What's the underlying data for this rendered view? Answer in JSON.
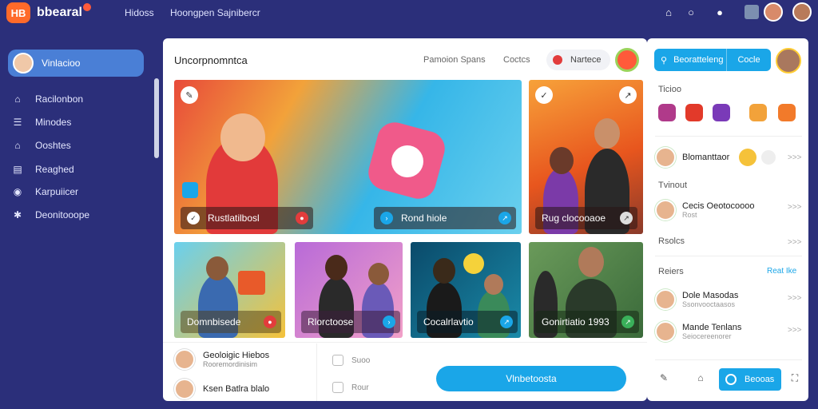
{
  "app": {
    "logo_badge": "HB",
    "logo_text": "bbearal",
    "nav": [
      "Hidoss",
      "Hoongpen Sajnibercr"
    ]
  },
  "sidebar": {
    "user_name": "Vinlacioo",
    "items": [
      {
        "label": "Racilonbon",
        "icon": "home-icon"
      },
      {
        "label": "Minodes",
        "icon": "list-icon"
      },
      {
        "label": "Ooshtes",
        "icon": "stack-icon"
      },
      {
        "label": "Reaghed",
        "icon": "calendar-icon"
      },
      {
        "label": "Karpuiicer",
        "icon": "globe-icon"
      },
      {
        "label": "Deonitooope",
        "icon": "puzzle-icon"
      }
    ]
  },
  "main": {
    "title": "Uncorpnomntca",
    "tabs": [
      "Pamoion Spans",
      "Coctcs"
    ],
    "pill_label": "Nartece",
    "cards": [
      {
        "label": "Rustlatilbosl"
      },
      {
        "label": "Rond hiole"
      },
      {
        "label": "Rug clocooaoe"
      },
      {
        "label": "Domnbisede"
      },
      {
        "label": "Rlorctoose"
      },
      {
        "label": "Cocalrlavtio"
      },
      {
        "label": "Gonirtiatio 1993"
      }
    ],
    "list": [
      {
        "name": "Geoloigic Hiebos",
        "sub": "Rooremordinisim"
      },
      {
        "name": "Ksen Batlra blalo",
        "sub": ""
      }
    ],
    "small_items": [
      "Suoo",
      "Rour"
    ],
    "cta_label": "Vlnbetoosta"
  },
  "right": {
    "search_label": "Beoratteleng",
    "search_btn": "Cocle",
    "section_stickers": "Ticioo",
    "section_2": "Tvinout",
    "section_3": "Rsolcs",
    "section_4": "Reiers",
    "link_4": "Reat Ike",
    "more": ">>>",
    "people": [
      {
        "name": "Blomanttaor",
        "sub": ""
      },
      {
        "name": "Cecis Oeotocoooo",
        "sub": "Rost"
      },
      {
        "name": "Dole Masodas",
        "sub": "Ssonvooctaasos"
      },
      {
        "name": "Mande Tenlans",
        "sub": "Seiocereenorer"
      }
    ],
    "bottom_btn": "Beooas"
  },
  "colors": {
    "background": "#2b2f7a",
    "accent": "#1aa6e8",
    "brand": "#ff6a2a"
  }
}
